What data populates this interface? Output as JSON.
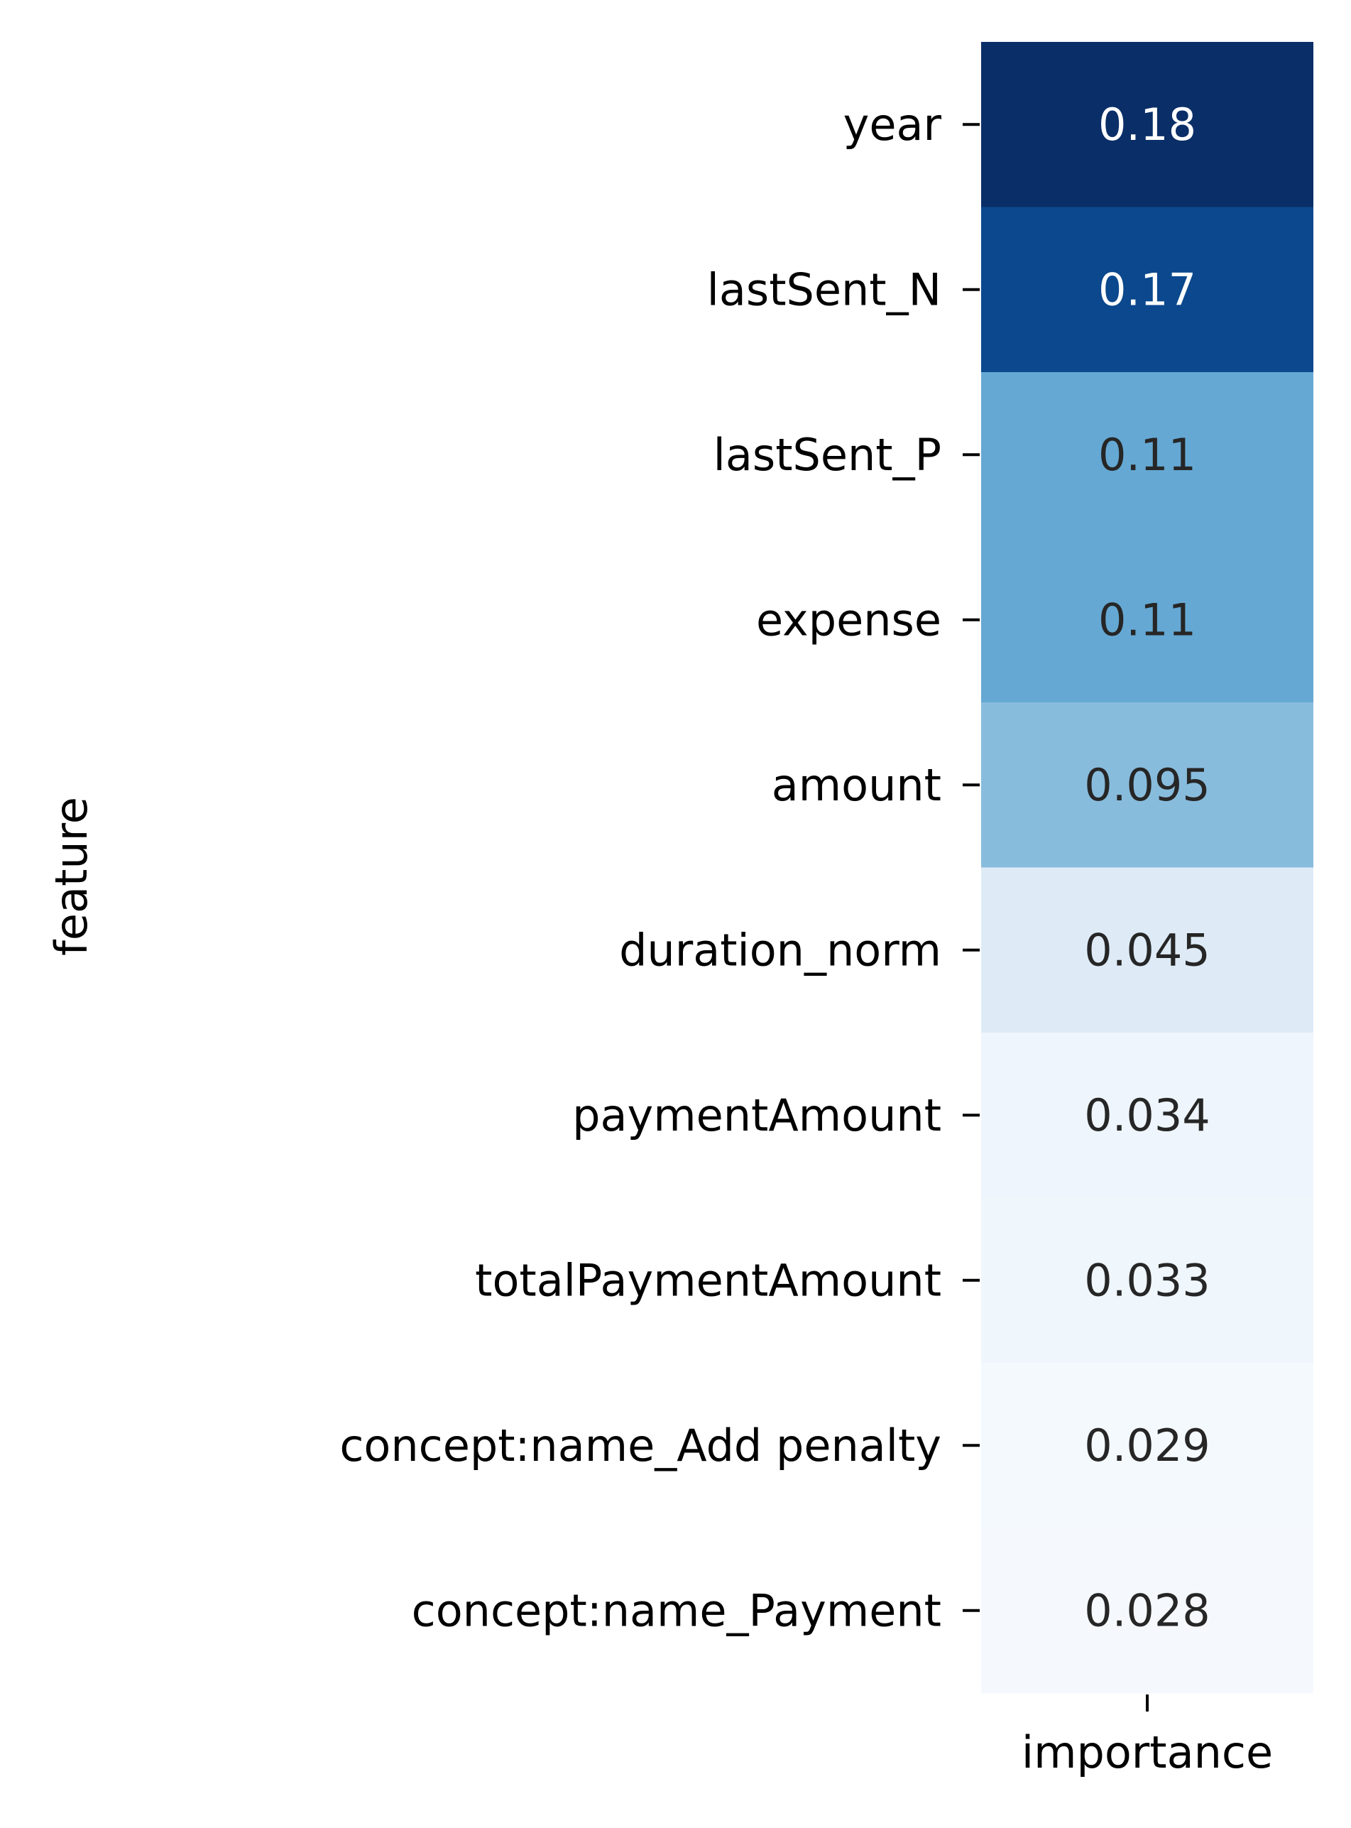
{
  "chart_data": {
    "type": "heatmap",
    "title": "",
    "xlabel": "",
    "ylabel": "feature",
    "x_categories": [
      "importance"
    ],
    "y_categories": [
      "year",
      "lastSent_N",
      "lastSent_P",
      "expense",
      "amount",
      "duration_norm",
      "paymentAmount",
      "totalPaymentAmount",
      "concept:name_Add penalty",
      "concept:name_Payment"
    ],
    "values": [
      0.18,
      0.17,
      0.11,
      0.11,
      0.095,
      0.045,
      0.034,
      0.033,
      0.029,
      0.028
    ],
    "value_labels": [
      "0.18",
      "0.17",
      "0.11",
      "0.11",
      "0.095",
      "0.045",
      "0.034",
      "0.033",
      "0.029",
      "0.028"
    ],
    "colormap": "Blues",
    "colorbar": false,
    "cell_colors": [
      "#0a2e67",
      "#0b488d",
      "#65a8d3",
      "#65a8d3",
      "#88bcdd",
      "#deebf7",
      "#eef5fc",
      "#eff6fc",
      "#f4f9fe",
      "#f5f9fe"
    ],
    "light_text_color": "#ffffff",
    "dark_text_color": "#262626",
    "tick_text_color": "#000000"
  }
}
